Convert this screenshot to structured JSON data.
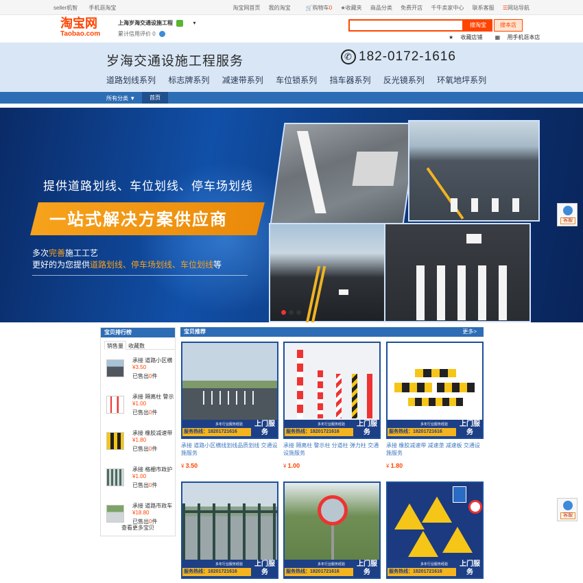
{
  "topbar": {
    "left": [
      "seller机智",
      "手机逛淘宝"
    ],
    "right": [
      "淘宝网首页",
      "我的淘宝",
      "购物车",
      "收藏夹",
      "商品分类",
      "免费开店",
      "千牛卖家中心",
      "联系客服",
      "网站导航"
    ],
    "cart_count": "0"
  },
  "header": {
    "logo_cn": "淘宝网",
    "logo_en": "Taobao.com",
    "shop_name": "上海岁海交通设施工程",
    "credit_label": "累计信用评价",
    "credit_value": "0",
    "search_placeholder": "",
    "search_all_button": "搜淘宝",
    "search_shop_button": "搜本店",
    "fav_shop": "收藏店铺",
    "mobile_shop": "用手机逛本店"
  },
  "banner": {
    "title": "岁海交通设施工程服务",
    "phone": "182-0172-1616",
    "categories": [
      "道路划线系列",
      "标志牌系列",
      "减速带系列",
      "车位锁系列",
      "挡车器系列",
      "反光镜系列",
      "环氧地坪系列"
    ]
  },
  "nav": {
    "all_categories": "所有分类",
    "home": "首页"
  },
  "hero": {
    "line1": "提供道路划线、车位划线、停车场划线",
    "line2": "一站式解决方案供应商",
    "line3_a": "多次",
    "line3_b": "完善",
    "line3_c": "施工工艺",
    "line4_a": "更好的为您提供",
    "line4_b": "道路划线、停车场划线、车位划线",
    "line4_c": "等",
    "slide_count": 3,
    "active_slide": 0
  },
  "side": {
    "kefu_label": "客服"
  },
  "ranking": {
    "title": "宝贝排行榜",
    "tabs": [
      "销售量",
      "收藏数"
    ],
    "sold_prefix": "已售出",
    "sold_suffix": "件",
    "items": [
      {
        "name": "承接 道路小区横",
        "price": "¥3.50",
        "sold": "0"
      },
      {
        "name": "承接 隔离柱 警示",
        "price": "¥1.00",
        "sold": "0"
      },
      {
        "name": "承接 橡胶减速带",
        "price": "¥1.80",
        "sold": "0"
      },
      {
        "name": "承接 格栅市政护",
        "price": "¥1.00",
        "sold": "0"
      },
      {
        "name": "承接 道路市政车",
        "price": "¥18.80",
        "sold": "0"
      }
    ],
    "see_all": "查看更多宝贝"
  },
  "recommend": {
    "title": "宝贝推荐",
    "more": "更多>",
    "service_hotline": "服务热线：18201721616",
    "service_tag": "多年行业服务经验",
    "service_door": "上门服务",
    "products": [
      {
        "title": "承接 道路小区横线划线品质划线 交通设施服务",
        "price": "3.50"
      },
      {
        "title": "承接 隔离柱 警示柱 分道柱 弹力柱 交通设施服务",
        "price": "1.00"
      },
      {
        "title": "承接 橡胶减速带 减速垄 减速板 交通设施服务",
        "price": "1.80"
      },
      {
        "title": "",
        "price": ""
      },
      {
        "title": "",
        "price": ""
      },
      {
        "title": "",
        "price": ""
      }
    ]
  }
}
